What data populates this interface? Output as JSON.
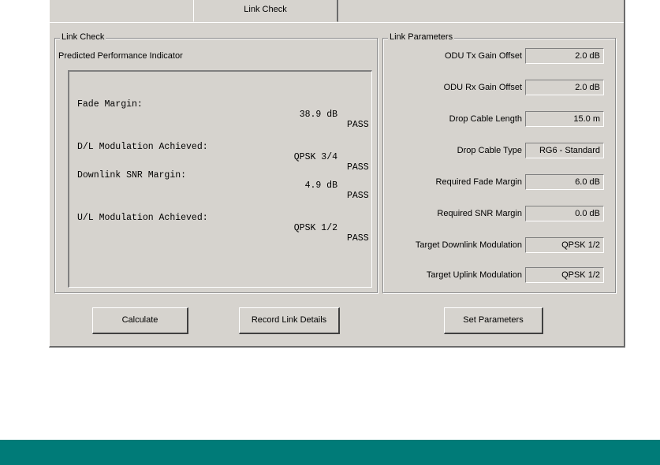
{
  "tab": {
    "label": "Link Check"
  },
  "link_check": {
    "legend": "Link Check",
    "subtitle": "Predicted Performance Indicator",
    "rows": [
      {
        "label": "Fade Margin:",
        "value": "38.9 dB",
        "status": "PASS"
      },
      {
        "label": "D/L Modulation Achieved:",
        "value": "QPSK 3/4",
        "status": "PASS"
      },
      {
        "label": "Downlink SNR Margin:",
        "value": "4.9 dB",
        "status": "PASS"
      },
      {
        "label": "U/L Modulation Achieved:",
        "value": "QPSK 1/2",
        "status": "PASS"
      }
    ]
  },
  "link_parameters": {
    "legend": "Link Parameters",
    "items": [
      {
        "label": "ODU Tx Gain Offset",
        "value": "2.0 dB"
      },
      {
        "label": "ODU Rx Gain Offset",
        "value": "2.0 dB"
      },
      {
        "label": "Drop Cable Length",
        "value": "15.0 m"
      },
      {
        "label": "Drop Cable Type",
        "value": "RG6 - Standard"
      },
      {
        "label": "Required Fade Margin",
        "value": "6.0 dB"
      },
      {
        "label": "Required SNR Margin",
        "value": "0.0 dB"
      },
      {
        "label": "Target Downlink Modulation",
        "value": "QPSK 1/2"
      },
      {
        "label": "Target Uplink Modulation",
        "value": "QPSK 1/2"
      }
    ]
  },
  "buttons": {
    "calculate": "Calculate",
    "record": "Record Link Details",
    "set_params": "Set Parameters"
  },
  "colors": {
    "dialog_bg": "#d6d3ce",
    "footer": "#007b78"
  }
}
